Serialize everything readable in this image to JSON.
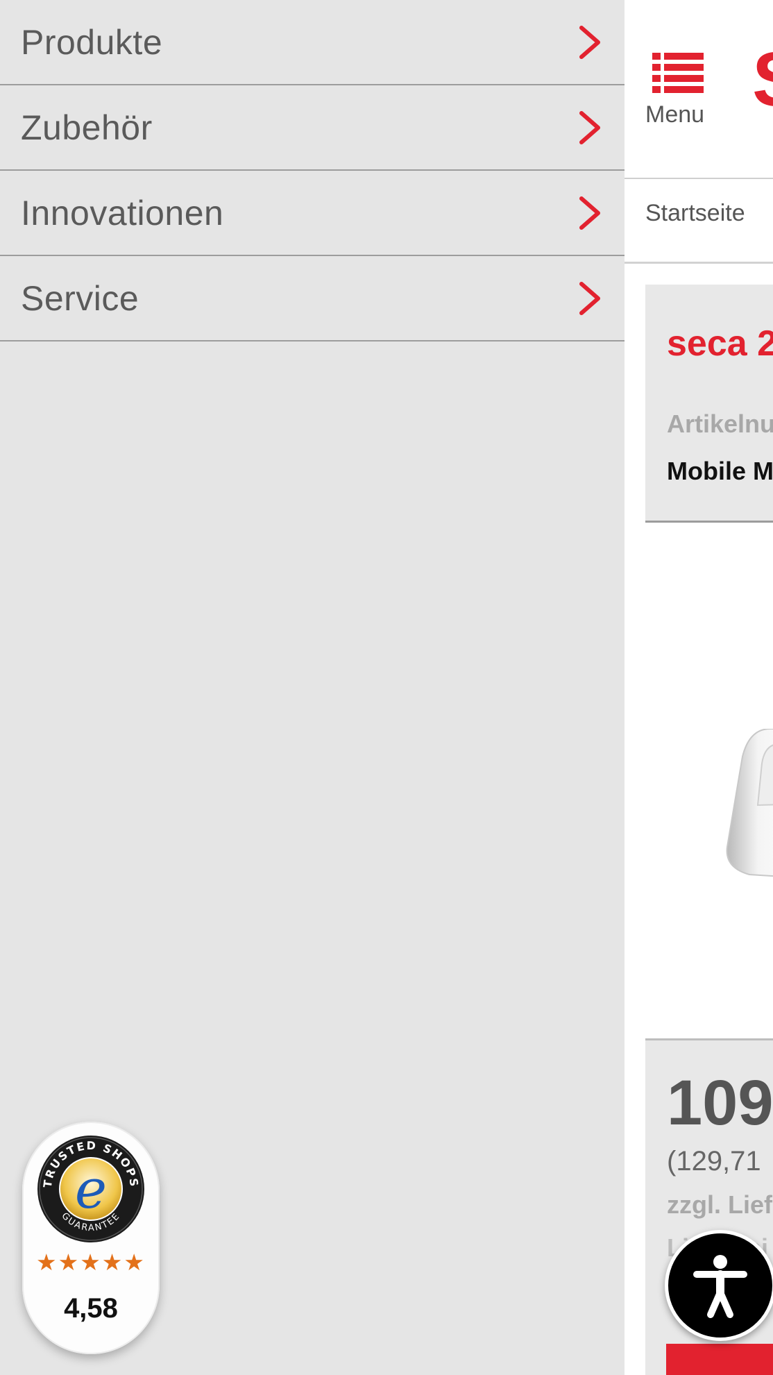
{
  "drawer": {
    "items": [
      {
        "label": "Produkte"
      },
      {
        "label": "Zubehör"
      },
      {
        "label": "Innovationen"
      },
      {
        "label": "Service"
      }
    ]
  },
  "trusted_shops": {
    "seal_text_top": "TRUSTED SHOPS",
    "seal_text_bottom": "GUARANTEE",
    "seal_letter": "e",
    "stars": "★★★★★",
    "stars_value": 4.58,
    "rating": "4,58"
  },
  "header": {
    "menu_label": "Menu",
    "logo_partial": "S",
    "brand_color": "#e2222f"
  },
  "breadcrumb": {
    "home": "Startseite"
  },
  "product": {
    "title_partial": "seca 2",
    "article_label_partial": "Artikelnu",
    "subtitle_partial": "Mobile M"
  },
  "price": {
    "main_partial": "109",
    "gross_partial": "(129,71",
    "shipping_partial": "zzgl. Lief",
    "extra_partial": "Lieferzei"
  },
  "icons": {
    "menu": "list-icon",
    "chevron": "chevron-right-icon",
    "accessibility": "accessibility-icon"
  }
}
